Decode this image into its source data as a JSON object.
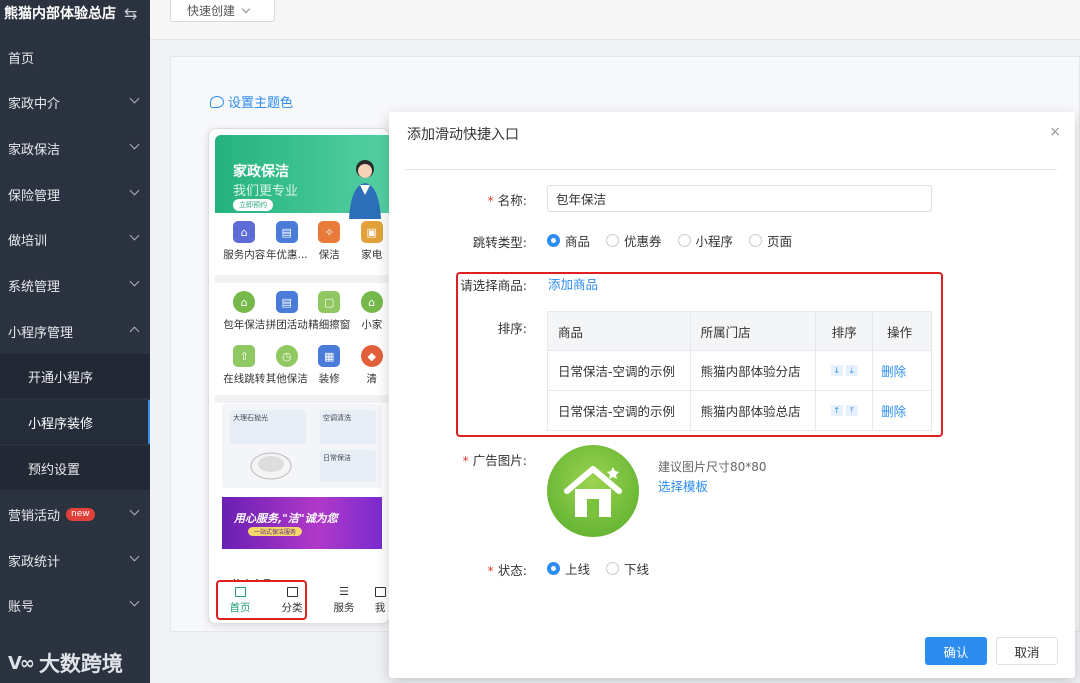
{
  "sidebar": {
    "brand": "熊猫内部体验总店",
    "items": [
      {
        "label": "首页"
      },
      {
        "label": "家政中介"
      },
      {
        "label": "家政保洁"
      },
      {
        "label": "保险管理"
      },
      {
        "label": "做培训"
      },
      {
        "label": "系统管理"
      },
      {
        "label": "小程序管理"
      },
      {
        "label": "开通小程序"
      },
      {
        "label": "小程序装修"
      },
      {
        "label": "预约设置"
      },
      {
        "label": "营销活动",
        "badge": "new"
      },
      {
        "label": "家政统计"
      },
      {
        "label": "账号"
      }
    ]
  },
  "watermark": "大数跨境",
  "topbar": {
    "quick_create": "快速创建"
  },
  "content": {
    "theme_link": "设置主题色"
  },
  "phone": {
    "hero_title": "家政保洁",
    "hero_subtitle": "我们更专业",
    "hero_button": "立即预约",
    "row1": [
      "服务内容",
      "年优惠...",
      "保洁",
      "家电"
    ],
    "row2": [
      "包年保洁",
      "拼团活动",
      "精细擦窗",
      "小家"
    ],
    "row3": [
      "在线跳转",
      "其他保洁",
      "装修",
      "清"
    ],
    "promo_cards": [
      "大理石抛光",
      "空调清洗",
      "日常保洁"
    ],
    "banner_title": "用心服务,\"洁\"诚为您",
    "banner_sub": "一站式保洁服务",
    "hot_label": "热卖产品",
    "tabs": [
      "首页",
      "分类",
      "服务",
      "我"
    ]
  },
  "modal": {
    "title": "添加滑动快捷入口",
    "close": "×",
    "name_label": "名称:",
    "name_value": "包年保洁",
    "jump_label": "跳转类型:",
    "jump_options": [
      "商品",
      "优惠券",
      "小程序",
      "页面"
    ],
    "goods_label": "请选择商品:",
    "add_goods": "添加商品",
    "sort_label": "排序:",
    "table": {
      "headers": [
        "商品",
        "所属门店",
        "排序",
        "操作"
      ],
      "rows": [
        {
          "product": "日常保洁-空调的示例",
          "store": "熊猫内部体验分店",
          "action": "删除"
        },
        {
          "product": "日常保洁-空调的示例",
          "store": "熊猫内部体验总店",
          "action": "删除"
        }
      ]
    },
    "ad_label": "广告图片:",
    "ad_hint": "建议图片尺寸80*80",
    "ad_choose": "选择模板",
    "status_label": "状态:",
    "status_options": [
      "上线",
      "下线"
    ],
    "confirm": "确认",
    "cancel": "取消"
  },
  "colors": {
    "primary": "#2c8cf0",
    "sidebar_bg": "#2c3340",
    "highlight_frame": "#e02020",
    "theme_green": "#25b27f"
  }
}
